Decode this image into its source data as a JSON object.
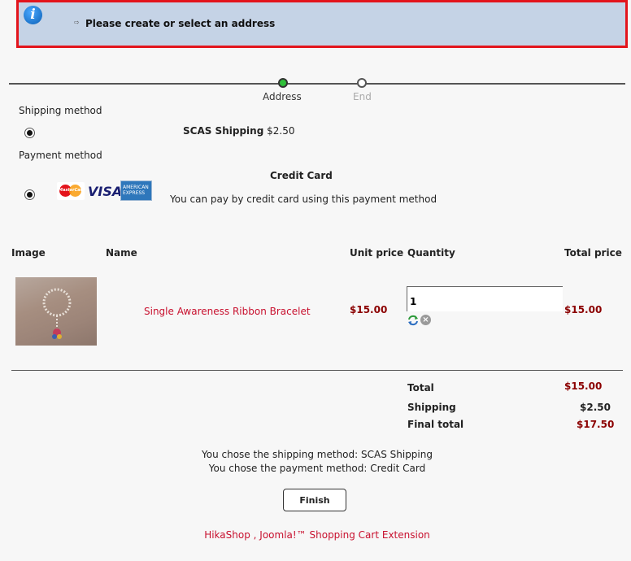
{
  "notice": {
    "text": "Please create or select an address",
    "arrow": "⇨",
    "icon": "i"
  },
  "steps": [
    {
      "label": "Address",
      "active": true
    },
    {
      "label": "End",
      "active": false
    }
  ],
  "shipping": {
    "heading": "Shipping method",
    "option_name": "SCAS Shipping",
    "option_price": "$2.50",
    "selected": true
  },
  "payment": {
    "heading": "Payment method",
    "option_name": "Credit Card",
    "description": "You can pay by credit card using this payment method",
    "selected": true,
    "logos": [
      "MasterCard",
      "VISA",
      "AMERICAN EXPRESS"
    ]
  },
  "cart": {
    "headers": {
      "image": "Image",
      "name": "Name",
      "unit_price": "Unit price",
      "quantity": "Quantity",
      "total_price": "Total price"
    },
    "items": [
      {
        "name": "Single Awareness Ribbon Bracelet",
        "unit_price": "$15.00",
        "quantity": "1",
        "total_price": "$15.00"
      }
    ]
  },
  "totals": {
    "total_label": "Total",
    "total_value": "$15.00",
    "shipping_label": "Shipping",
    "shipping_value": "$2.50",
    "final_label": "Final total",
    "final_value": "$17.50"
  },
  "summary": {
    "shipping_line": "You chose the shipping method: SCAS Shipping",
    "payment_line": "You chose the payment method: Credit Card"
  },
  "finish_label": "Finish",
  "footer_link": "HikaShop , Joomla!™ Shopping Cart Extension",
  "colors": {
    "accent_red": "#c8102e",
    "price_red": "#8b0000",
    "notice_bg": "#c5d3e6",
    "notice_border": "#e3141c",
    "active_step": "#2fbf3a"
  }
}
